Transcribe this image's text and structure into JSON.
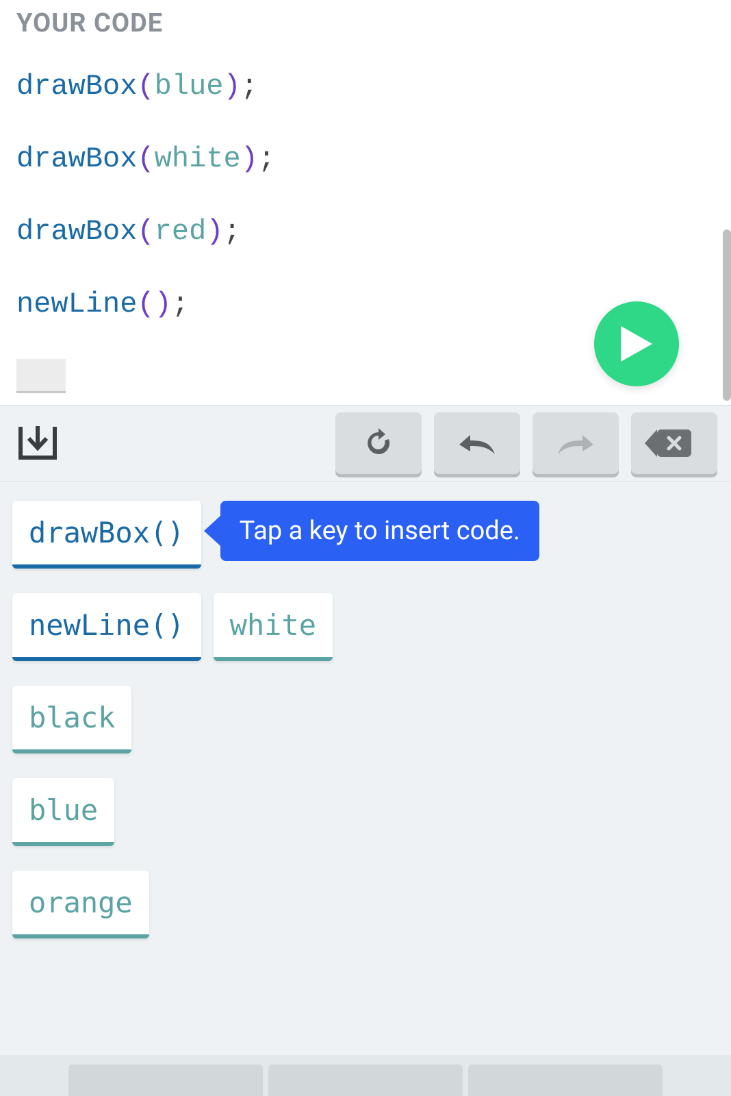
{
  "header": {
    "title": "YOUR CODE"
  },
  "code": {
    "lines": [
      {
        "func": "drawBox",
        "arg": "blue"
      },
      {
        "func": "drawBox",
        "arg": "white"
      },
      {
        "func": "drawBox",
        "arg": "red"
      },
      {
        "func": "newLine",
        "arg": ""
      }
    ]
  },
  "toolbar": {
    "import_icon": "import",
    "reset_icon": "reset",
    "undo_icon": "undo",
    "redo_icon": "redo",
    "delete_icon": "delete"
  },
  "run_button": "run",
  "tooltip": {
    "text": "Tap a key to insert code."
  },
  "keys": {
    "row1": [
      {
        "label": "drawBox()",
        "type": "func"
      }
    ],
    "row2": [
      {
        "label": "newLine()",
        "type": "func"
      },
      {
        "label": "white",
        "type": "arg"
      }
    ],
    "row3": [
      {
        "label": "black",
        "type": "arg"
      }
    ],
    "row4": [
      {
        "label": "blue",
        "type": "arg"
      }
    ],
    "row5": [
      {
        "label": "orange",
        "type": "arg"
      }
    ]
  }
}
